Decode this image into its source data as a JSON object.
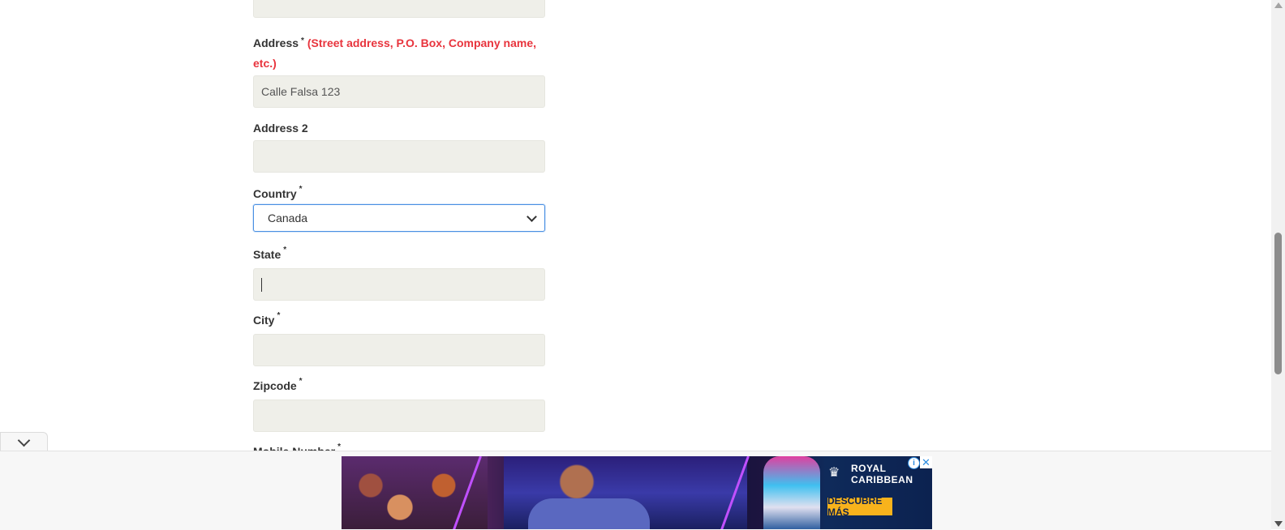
{
  "form": {
    "address": {
      "label": "Address",
      "required_mark": "*",
      "hint": "(Street address, P.O. Box, Company name, etc.)",
      "value": "Calle Falsa 123"
    },
    "address2": {
      "label": "Address 2",
      "value": ""
    },
    "country": {
      "label": "Country",
      "required_mark": "*",
      "selected": "Canada"
    },
    "state": {
      "label": "State",
      "required_mark": "*",
      "value": ""
    },
    "city": {
      "label": "City",
      "required_mark": "*",
      "value": ""
    },
    "zipcode": {
      "label": "Zipcode",
      "required_mark": "*",
      "value": ""
    },
    "mobile": {
      "label": "Mobile Number",
      "required_mark": "*"
    }
  },
  "ad": {
    "brand_line1": "ROYAL",
    "brand_line2": "CARIBBEAN",
    "cta": "DESCUBRE MÁS",
    "info_glyph": "i",
    "close_glyph": "✕"
  },
  "icons": {
    "collapse": "chevron-down-icon",
    "select": "chevron-down-icon"
  },
  "colors": {
    "input_bg": "#efefe9",
    "hint_red": "#e8343d",
    "focus_blue": "#4a90e2",
    "cta_yellow": "#f8b31c"
  }
}
